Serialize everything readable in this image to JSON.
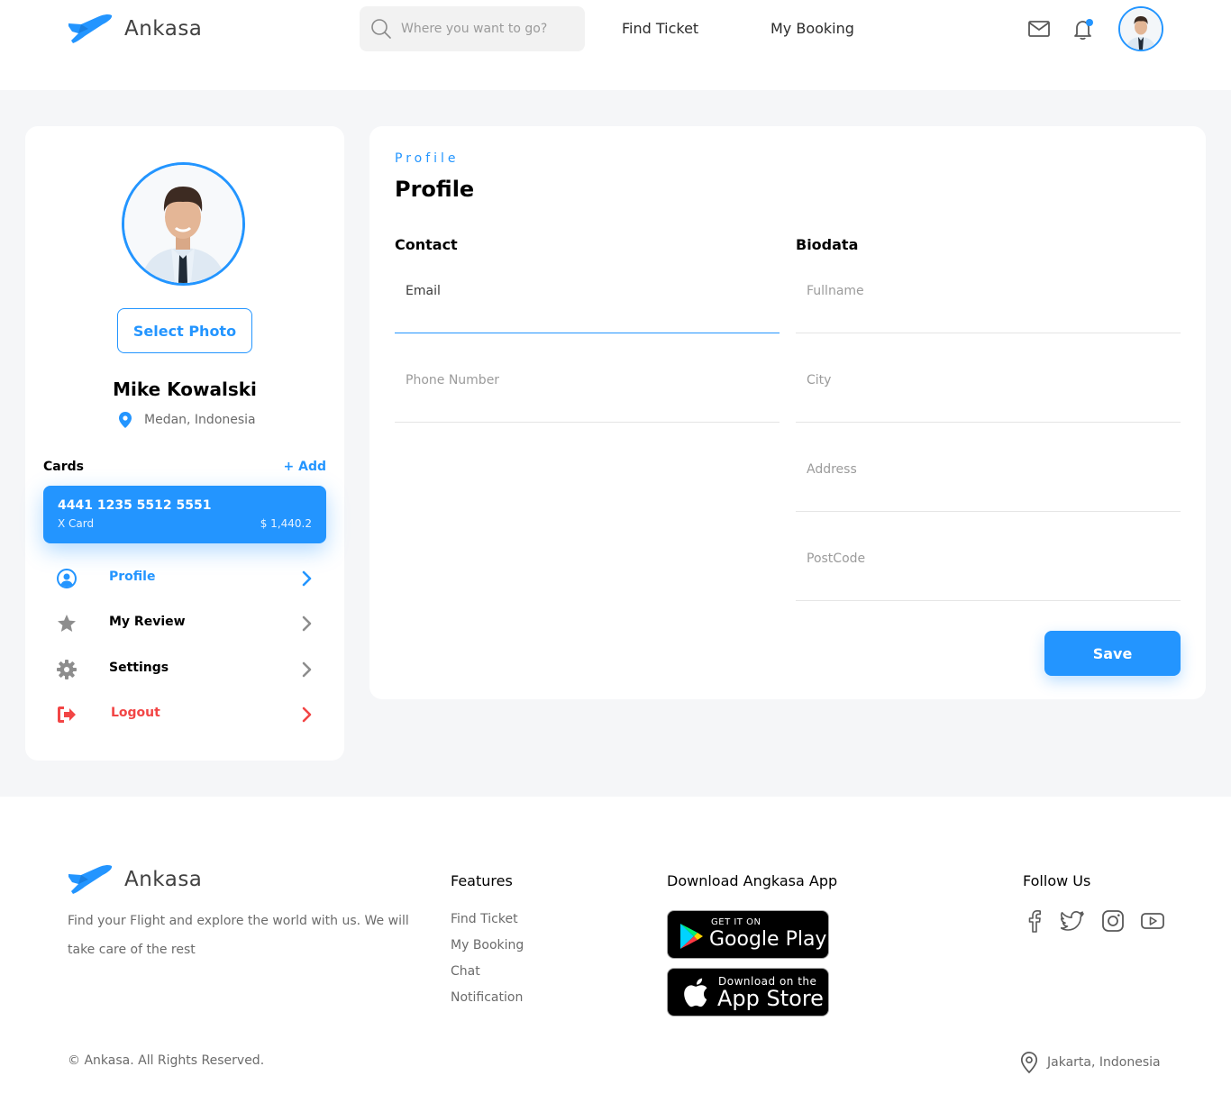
{
  "brand": {
    "name": "Ankasa",
    "accent": "#2395ff",
    "danger": "#f24545"
  },
  "header": {
    "search": {
      "placeholder": "Where you want to go?",
      "icon": "search-icon"
    },
    "nav": {
      "find_ticket": "Find Ticket",
      "my_booking": "My Booking"
    },
    "icons": [
      "mail-icon",
      "bell-icon"
    ],
    "notification_dot": true
  },
  "sidebar": {
    "select_photo_label": "Select Photo",
    "user_name": "Mike Kowalski",
    "user_location": "Medan, Indonesia",
    "cards_label": "Cards",
    "add_label": "+ Add",
    "card": {
      "number": "4441 1235 5512 5551",
      "type": "X Card",
      "balance": "$ 1,440.2"
    },
    "menu": [
      {
        "label": "Profile",
        "icon": "user-circle-icon",
        "active": true
      },
      {
        "label": "My Review",
        "icon": "star-icon",
        "active": false
      },
      {
        "label": "Settings",
        "icon": "gear-icon",
        "active": false
      },
      {
        "label": "Logout",
        "icon": "logout-icon",
        "active": false
      }
    ]
  },
  "profile": {
    "eyebrow": "Profile",
    "title": "Profile",
    "contact_title": "Contact",
    "biodata_title": "Biodata",
    "contact_fields": [
      {
        "label": "Email",
        "value": ""
      },
      {
        "label": "Phone Number",
        "value": ""
      }
    ],
    "biodata_fields": [
      {
        "label": "Fullname",
        "value": ""
      },
      {
        "label": "City",
        "value": ""
      },
      {
        "label": "Address",
        "value": ""
      },
      {
        "label": "PostCode",
        "value": ""
      }
    ],
    "save_label": "Save"
  },
  "footer": {
    "description": "Find your Flight and explore the world with us. We will take care of the rest",
    "features_title": "Features",
    "features": [
      "Find Ticket",
      "My Booking",
      "Chat",
      "Notification"
    ],
    "download_title": "Download Angkasa App",
    "google_play": {
      "small": "GET IT ON",
      "big": "Google Play"
    },
    "app_store": {
      "small": "Download on the",
      "big": "App Store"
    },
    "follow_title": "Follow Us",
    "social": [
      "facebook-icon",
      "twitter-icon",
      "instagram-icon",
      "youtube-icon"
    ],
    "copyright": "© Ankasa. All Rights Reserved.",
    "location": "Jakarta, Indonesia"
  }
}
